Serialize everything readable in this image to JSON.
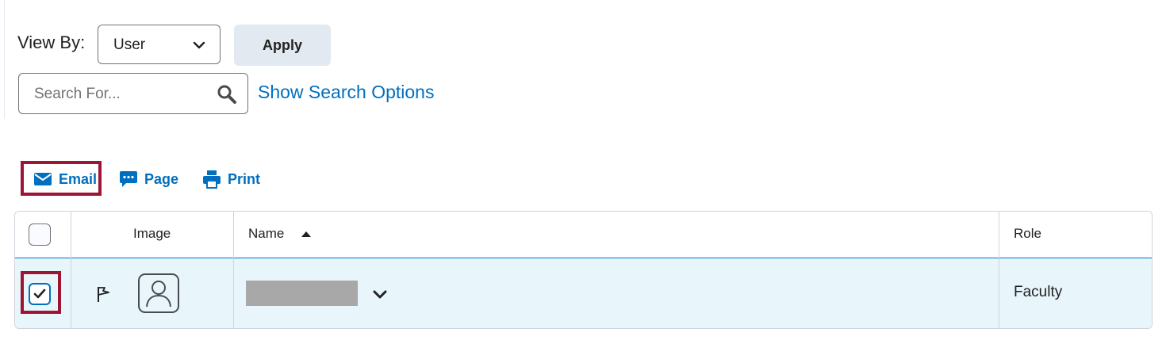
{
  "filters": {
    "view_by_label": "View By:",
    "view_by_value": "User",
    "apply_label": "Apply",
    "search_placeholder": "Search For...",
    "show_search_options": "Show Search Options"
  },
  "actions": [
    {
      "label": "Email",
      "icon": "envelope-icon",
      "highlighted": true
    },
    {
      "label": "Page",
      "icon": "chat-bubble-icon",
      "highlighted": false
    },
    {
      "label": "Print",
      "icon": "printer-icon",
      "highlighted": false
    }
  ],
  "table": {
    "columns": [
      "Image",
      "Name",
      "Role"
    ],
    "sort_column": "Name",
    "sort_direction": "ascending",
    "rows": [
      {
        "selected": true,
        "flag": "flag-icon",
        "avatar": "user-avatar-icon",
        "name": "",
        "role": "Faculty"
      }
    ]
  },
  "colors": {
    "link": "#006fbf",
    "highlight_border": "#9d1535",
    "selected_row_bg": "#e8f6fc",
    "button_bg": "#e3e9f1"
  }
}
